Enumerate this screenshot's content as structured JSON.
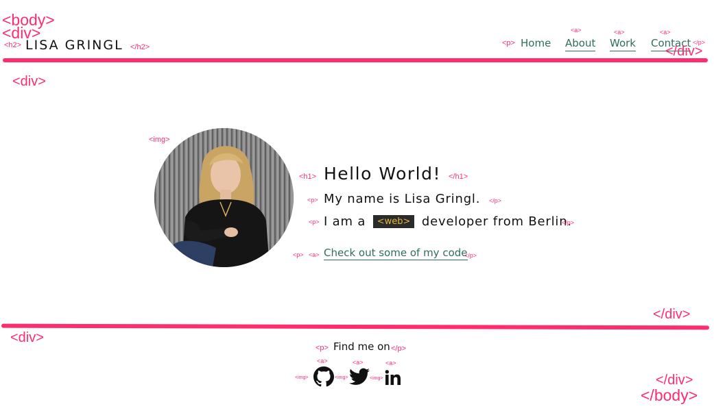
{
  "tags": {
    "body_open": "<body>",
    "div_open": "<div>",
    "h2_open": "<h2>",
    "h2_close": "</h2>",
    "p_open": "<p>",
    "p_close": "</p>",
    "a_open": "<a>",
    "div_close": "</div>",
    "img_open": "<img>",
    "h1_open": "<h1>",
    "h1_close": "</h1>",
    "body_close": "</body>"
  },
  "header": {
    "logo": "LISA GRINGL",
    "nav": [
      {
        "label": "Home"
      },
      {
        "label": "About"
      },
      {
        "label": "Work"
      },
      {
        "label": "Contact"
      }
    ]
  },
  "hero": {
    "title": "Hello World!",
    "name_line": "My name is Lisa Gringl.",
    "role_prefix": "I am a",
    "role_chip": "<web>",
    "role_suffix": "developer from Berlin.",
    "code_link": "Check out some of my code"
  },
  "footer": {
    "find_me": "Find me on",
    "social": [
      {
        "icon": "github-icon"
      },
      {
        "icon": "twitter-icon"
      },
      {
        "icon": "linkedin-icon"
      }
    ]
  },
  "colors": {
    "annotation": "#ff2d6f",
    "link": "#2e6e5a",
    "chip_bg": "#2b2b2b",
    "chip_text": "#e6b53a"
  }
}
